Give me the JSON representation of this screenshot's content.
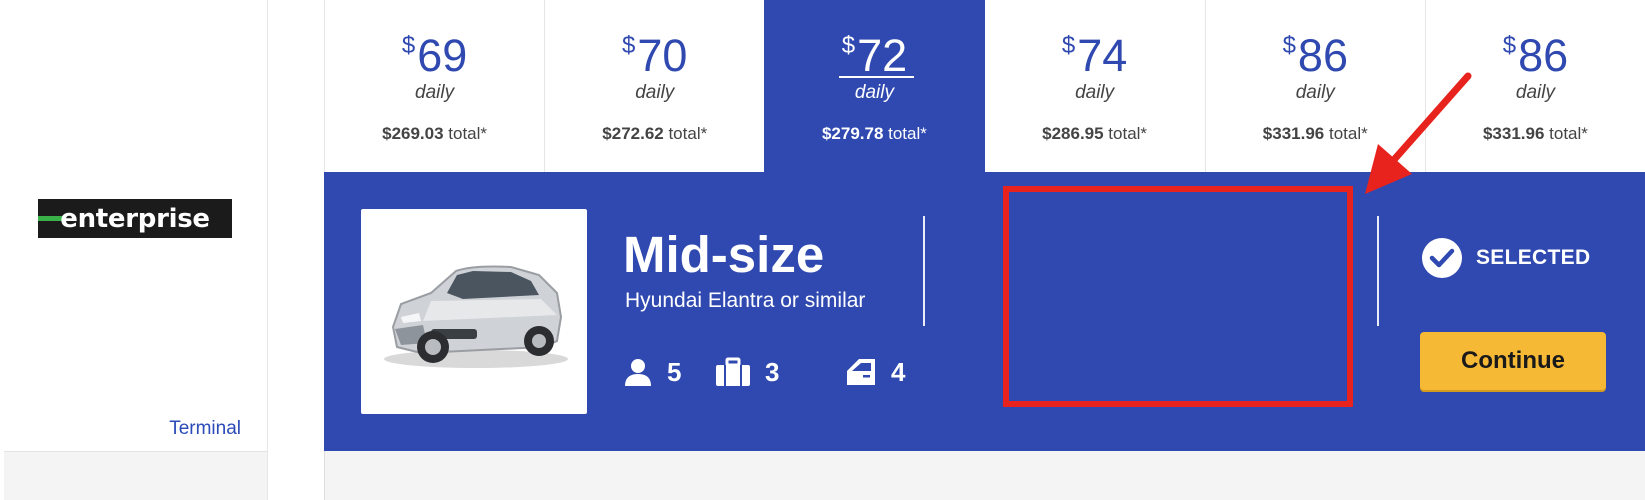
{
  "vendor": {
    "logo_text": "enterprise",
    "location_link": "Terminal"
  },
  "prices": [
    {
      "currency": "$",
      "amount": "69",
      "period": "daily",
      "total_value": "$269.03",
      "total_suffix": " total*",
      "selected": false
    },
    {
      "currency": "$",
      "amount": "70",
      "period": "daily",
      "total_value": "$272.62",
      "total_suffix": " total*",
      "selected": false
    },
    {
      "currency": "$",
      "amount": "72",
      "period": "daily",
      "total_value": "$279.78",
      "total_suffix": " total*",
      "selected": true
    },
    {
      "currency": "$",
      "amount": "74",
      "period": "daily",
      "total_value": "$286.95",
      "total_suffix": " total*",
      "selected": false
    },
    {
      "currency": "$",
      "amount": "86",
      "period": "daily",
      "total_value": "$331.96",
      "total_suffix": " total*",
      "selected": false
    },
    {
      "currency": "$",
      "amount": "86",
      "period": "daily",
      "total_value": "$331.96",
      "total_suffix": " total*",
      "selected": false
    }
  ],
  "car": {
    "class": "Mid-size",
    "model": "Hyundai Elantra or similar",
    "passengers": "5",
    "bags": "3",
    "doors": "4"
  },
  "selection": {
    "status": "SELECTED",
    "continue_label": "Continue"
  },
  "colors": {
    "brand_blue": "#2f49b0",
    "button_yellow": "#f6b936",
    "annotation_red": "#e8231e"
  }
}
